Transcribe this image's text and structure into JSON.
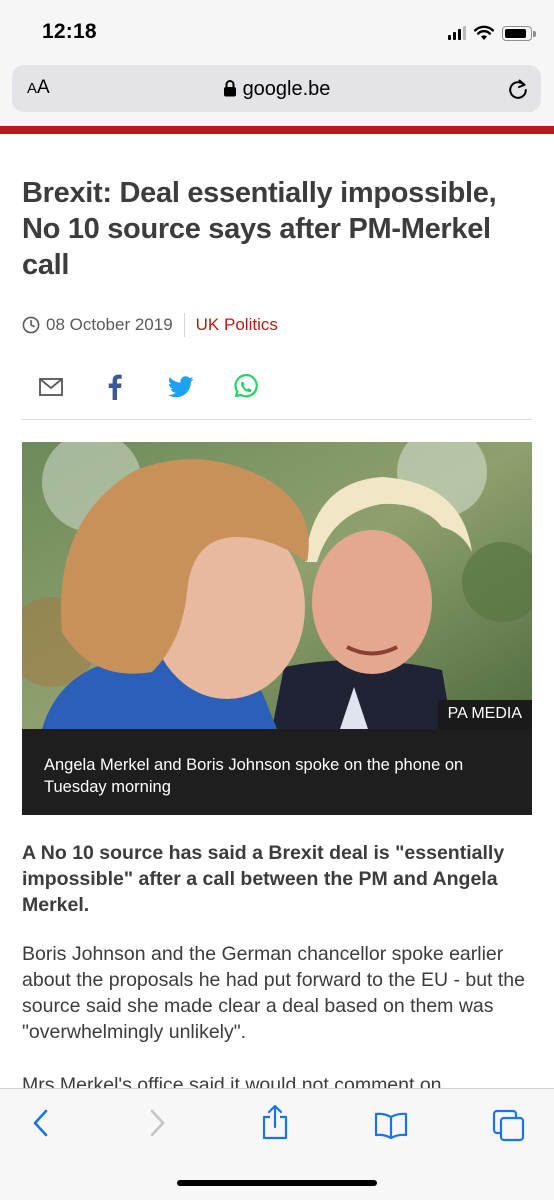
{
  "status_bar": {
    "time": "12:18",
    "signal_icon": "cellular-signal-icon",
    "wifi_icon": "wifi-icon",
    "battery_icon": "battery-icon"
  },
  "browser": {
    "text_size_label_small": "A",
    "text_size_label_large": "A",
    "url": "google.be",
    "lock_icon": "lock-icon",
    "reload_icon": "reload-icon"
  },
  "article": {
    "headline": "Brexit: Deal essentially impossible, No 10 source says after PM-Merkel call",
    "date": "08 October 2019",
    "topic": "UK Politics",
    "share_icons": [
      "email-icon",
      "facebook-icon",
      "twitter-icon",
      "whatsapp-icon"
    ],
    "image_credit": "PA MEDIA",
    "image_caption": "Angela Merkel and Boris Johnson spoke on the phone on Tuesday morning",
    "lead": "A No 10 source has said a Brexit deal is \"essentially impossible\" after a call between the PM and Angela Merkel.",
    "paragraph_1": "Boris Johnson and the German chancellor spoke earlier about the proposals he had put forward to the EU - but the source said she made clear a deal based on them was \"overwhelmingly unlikely\".",
    "paragraph_2": "Mrs Merkel's office said it would not comment on"
  },
  "toolbar": {
    "icons": [
      "back-icon",
      "forward-icon",
      "share-icon",
      "bookmarks-icon",
      "tabs-icon"
    ]
  },
  "colors": {
    "accent_red": "#bb1919",
    "link_blue": "#1a73e8",
    "facebook": "#3b5998",
    "twitter": "#1da1f2",
    "whatsapp": "#25d366"
  }
}
